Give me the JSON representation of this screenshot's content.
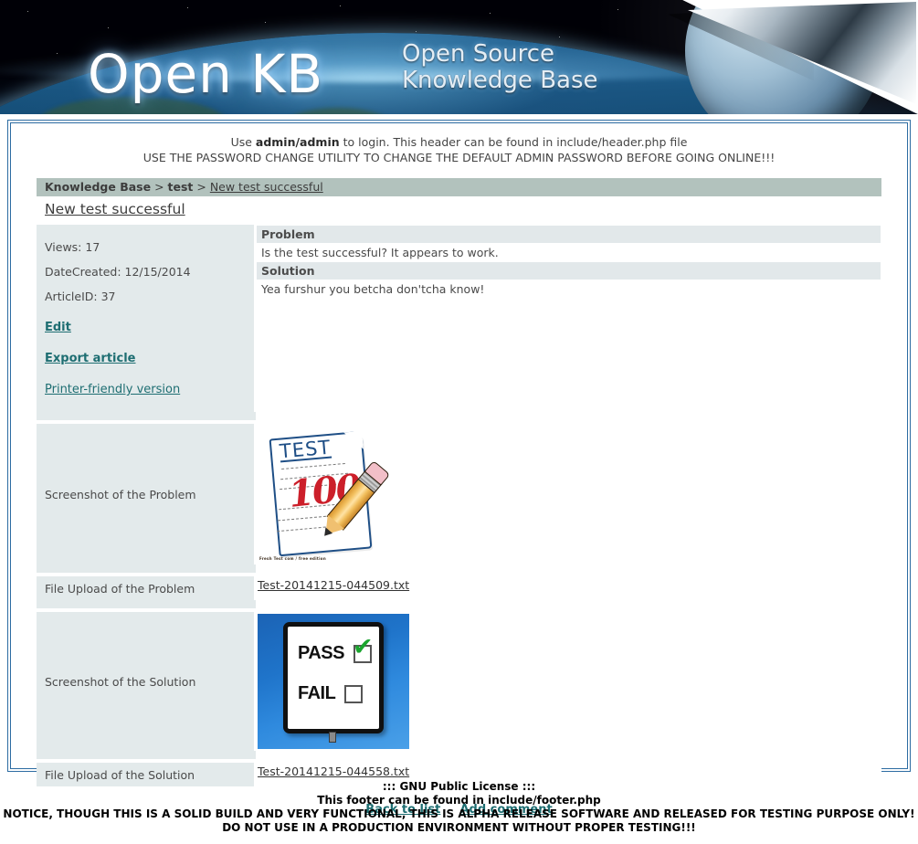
{
  "banner": {
    "title": "Open KB",
    "subtitle_line1": "Open Source",
    "subtitle_line2": "Knowledge Base"
  },
  "site_notice": {
    "line1_prefix": "Use ",
    "line1_credentials": "admin/admin",
    "line1_suffix": " to login. This header can be found in include/header.php file",
    "line2": "USE THE PASSWORD CHANGE UTILITY TO CHANGE THE DEFAULT ADMIN PASSWORD BEFORE GOING ONLINE!!!"
  },
  "breadcrumb": {
    "root": "Knowledge Base",
    "sep": " > ",
    "category": "test",
    "current": "New test successful"
  },
  "article": {
    "title": "New test successful",
    "views_label": "Views: 17",
    "date_created_label": "DateCreated: 12/15/2014",
    "article_id_label": "ArticleID: 37",
    "edit_link": "Edit",
    "export_link": "Export article",
    "printer_link": "Printer-friendly version",
    "problem_heading": "Problem",
    "problem_text": "Is the test successful? It appears to work.",
    "solution_heading": "Solution",
    "solution_text": "Yea furshur you betcha don'tcha know!",
    "screenshot_problem_label": "Screenshot of the Problem",
    "file_problem_label": "File Upload of the Problem",
    "file_problem_name": "Test-20141215-044509.txt",
    "screenshot_solution_label": "Screenshot of the Solution",
    "file_solution_label": "File Upload of the Solution",
    "file_solution_name": "Test-20141215-044558.txt"
  },
  "screenshot_problem_image": {
    "alt": "test-paper-100-percent-image",
    "paper_text": "TEST",
    "grade_text": "100",
    "grade_suffix": "%",
    "credit": "Fresh Test com / free edition"
  },
  "screenshot_solution_image": {
    "alt": "pass-fail-sign-image",
    "pass_label": "PASS",
    "fail_label": "FAIL",
    "pass_checked": true,
    "fail_checked": false
  },
  "actions": {
    "back_to_list": "Back to list",
    "add_comment": "Add comment"
  },
  "footer": {
    "line1": "::: GNU Public License :::",
    "line2": "This footer can be found in include/footer.php",
    "line3": "NOTICE, THOUGH THIS IS A SOLID BUILD AND VERY FUNCTIONAL, THIS IS ALPHA RELEASE SOFTWARE AND RELEASED FOR TESTING PURPOSE ONLY!",
    "line4": "DO NOT USE IN A PRODUCTION ENVIRONMENT WITHOUT PROPER TESTING!!!"
  },
  "colors": {
    "banner_bg": "#000007",
    "box_border": "#2d6ca2",
    "breadcrumb_bg": "#b2c2bd",
    "meta_bg": "#e3eaeb",
    "section_head_bg": "#e2e8ea",
    "link_teal": "#1e6e72",
    "text_gray": "#4a4a4a"
  }
}
